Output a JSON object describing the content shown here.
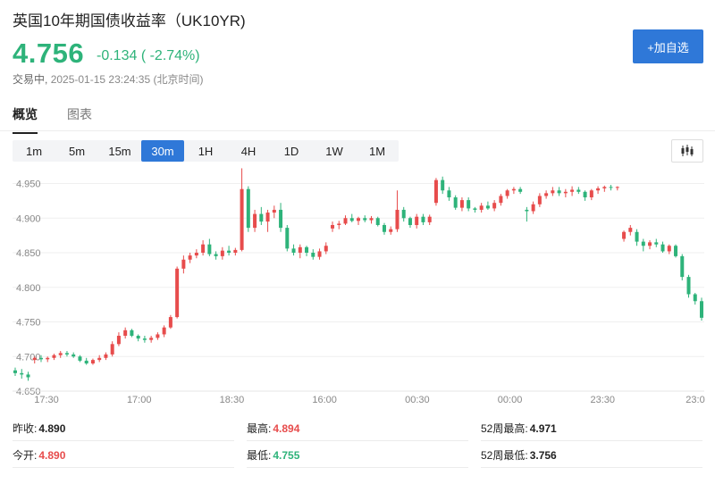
{
  "header": {
    "title": "英国10年期国债收益率（UK10YR)",
    "price": "4.756",
    "change": "-0.134 ( -2.74%)",
    "status": "交易中,",
    "timestamp": "2025-01-15 23:24:35 (北京时间)",
    "add_button": "+加自选"
  },
  "colors": {
    "up": "#e74c4c",
    "down": "#2eb37a",
    "accent": "#2f78d8"
  },
  "tabs": [
    {
      "label": "概览",
      "active": true
    },
    {
      "label": "图表",
      "active": false
    }
  ],
  "periods": [
    {
      "label": "1m",
      "active": false
    },
    {
      "label": "5m",
      "active": false
    },
    {
      "label": "15m",
      "active": false
    },
    {
      "label": "30m",
      "active": true
    },
    {
      "label": "1H",
      "active": false
    },
    {
      "label": "4H",
      "active": false
    },
    {
      "label": "1D",
      "active": false
    },
    {
      "label": "1W",
      "active": false
    },
    {
      "label": "1M",
      "active": false
    }
  ],
  "chart_type_icon": "candlestick-icon",
  "chart_data": {
    "type": "candlestick",
    "title": "",
    "xlabel": "",
    "ylabel": "",
    "ylim": [
      4.65,
      4.97
    ],
    "yticks": [
      "4.650",
      "4.700",
      "4.750",
      "4.800",
      "4.850",
      "4.900",
      "4.950"
    ],
    "xticks": [
      "17:30",
      "17:00",
      "18:30",
      "16:00",
      "00:30",
      "00:00",
      "23:30",
      "23:0"
    ],
    "grid": true,
    "candles": [
      [
        4.68,
        4.684,
        4.672,
        4.676
      ],
      [
        4.676,
        4.682,
        4.668,
        4.674
      ],
      [
        4.674,
        4.678,
        4.665,
        4.67
      ],
      [
        4.695,
        4.7,
        4.69,
        4.698
      ],
      [
        4.698,
        4.702,
        4.692,
        4.696
      ],
      [
        4.696,
        4.7,
        4.692,
        4.698
      ],
      [
        4.698,
        4.704,
        4.695,
        4.702
      ],
      [
        4.702,
        4.708,
        4.698,
        4.705
      ],
      [
        4.705,
        4.708,
        4.7,
        4.703
      ],
      [
        4.703,
        4.706,
        4.698,
        4.7
      ],
      [
        4.7,
        4.702,
        4.692,
        4.694
      ],
      [
        4.694,
        4.698,
        4.688,
        4.69
      ],
      [
        4.69,
        4.697,
        4.688,
        4.695
      ],
      [
        4.695,
        4.702,
        4.692,
        4.698
      ],
      [
        4.698,
        4.706,
        4.695,
        4.703
      ],
      [
        4.703,
        4.722,
        4.7,
        4.718
      ],
      [
        4.718,
        4.735,
        4.715,
        4.73
      ],
      [
        4.73,
        4.742,
        4.726,
        4.738
      ],
      [
        4.738,
        4.74,
        4.728,
        4.73
      ],
      [
        4.73,
        4.732,
        4.722,
        4.726
      ],
      [
        4.726,
        4.73,
        4.72,
        4.724
      ],
      [
        4.724,
        4.73,
        4.72,
        4.727
      ],
      [
        4.727,
        4.735,
        4.724,
        4.732
      ],
      [
        4.732,
        4.745,
        4.728,
        4.742
      ],
      [
        4.742,
        4.76,
        4.74,
        4.757
      ],
      [
        4.757,
        4.83,
        4.755,
        4.827
      ],
      [
        4.827,
        4.846,
        4.82,
        4.84
      ],
      [
        4.84,
        4.85,
        4.835,
        4.846
      ],
      [
        4.846,
        4.855,
        4.842,
        4.85
      ],
      [
        4.85,
        4.868,
        4.846,
        4.862
      ],
      [
        4.862,
        4.87,
        4.845,
        4.848
      ],
      [
        4.848,
        4.852,
        4.84,
        4.845
      ],
      [
        4.845,
        4.858,
        4.84,
        4.853
      ],
      [
        4.853,
        4.86,
        4.846,
        4.85
      ],
      [
        4.85,
        4.857,
        4.846,
        4.854
      ],
      [
        4.854,
        4.972,
        4.852,
        4.942
      ],
      [
        4.942,
        4.946,
        4.88,
        4.886
      ],
      [
        4.886,
        4.912,
        4.88,
        4.906
      ],
      [
        4.906,
        4.916,
        4.89,
        4.895
      ],
      [
        4.895,
        4.912,
        4.88,
        4.908
      ],
      [
        4.908,
        4.918,
        4.9,
        4.912
      ],
      [
        4.912,
        4.922,
        4.88,
        4.886
      ],
      [
        4.886,
        4.89,
        4.852,
        4.856
      ],
      [
        4.856,
        4.862,
        4.846,
        4.85
      ],
      [
        4.85,
        4.862,
        4.842,
        4.858
      ],
      [
        4.858,
        4.86,
        4.845,
        4.85
      ],
      [
        4.85,
        4.855,
        4.84,
        4.844
      ],
      [
        4.844,
        4.856,
        4.84,
        4.852
      ],
      [
        4.852,
        4.865,
        4.848,
        4.86
      ],
      [
        4.885,
        4.895,
        4.88,
        4.89
      ],
      [
        4.89,
        4.896,
        4.884,
        4.892
      ],
      [
        4.892,
        4.904,
        4.89,
        4.9
      ],
      [
        4.9,
        4.906,
        4.894,
        4.896
      ],
      [
        4.896,
        4.902,
        4.89,
        4.9
      ],
      [
        4.9,
        4.904,
        4.894,
        4.897
      ],
      [
        4.897,
        4.903,
        4.892,
        4.9
      ],
      [
        4.9,
        4.902,
        4.888,
        4.89
      ],
      [
        4.89,
        4.893,
        4.876,
        4.88
      ],
      [
        4.88,
        4.888,
        4.876,
        4.884
      ],
      [
        4.884,
        4.94,
        4.88,
        4.912
      ],
      [
        4.912,
        4.916,
        4.895,
        4.9
      ],
      [
        4.9,
        4.902,
        4.886,
        4.89
      ],
      [
        4.89,
        4.906,
        4.885,
        4.902
      ],
      [
        4.902,
        4.906,
        4.89,
        4.894
      ],
      [
        4.894,
        4.905,
        4.89,
        4.902
      ],
      [
        4.922,
        4.958,
        4.918,
        4.955
      ],
      [
        4.955,
        4.96,
        4.935,
        4.94
      ],
      [
        4.94,
        4.945,
        4.925,
        4.93
      ],
      [
        4.93,
        4.933,
        4.912,
        4.915
      ],
      [
        4.915,
        4.93,
        4.91,
        4.926
      ],
      [
        4.926,
        4.93,
        4.91,
        4.914
      ],
      [
        4.914,
        4.916,
        4.908,
        4.912
      ],
      [
        4.912,
        4.922,
        4.908,
        4.918
      ],
      [
        4.918,
        4.924,
        4.912,
        4.914
      ],
      [
        4.914,
        4.926,
        4.91,
        4.922
      ],
      [
        4.922,
        4.935,
        4.918,
        4.932
      ],
      [
        4.932,
        4.942,
        4.928,
        4.94
      ],
      [
        4.94,
        4.945,
        4.935,
        4.942
      ],
      [
        4.942,
        4.945,
        4.935,
        4.938
      ],
      [
        4.912,
        4.916,
        4.895,
        4.91
      ],
      [
        4.91,
        4.924,
        4.906,
        4.92
      ],
      [
        4.92,
        4.936,
        4.916,
        4.932
      ],
      [
        4.932,
        4.94,
        4.928,
        4.936
      ],
      [
        4.936,
        4.945,
        4.932,
        4.94
      ],
      [
        4.94,
        4.945,
        4.932,
        4.936
      ],
      [
        4.936,
        4.942,
        4.93,
        4.938
      ],
      [
        4.938,
        4.946,
        4.932,
        4.941
      ],
      [
        4.941,
        4.945,
        4.935,
        4.938
      ],
      [
        4.938,
        4.94,
        4.925,
        4.93
      ],
      [
        4.93,
        4.942,
        4.926,
        4.94
      ],
      [
        4.94,
        4.946,
        4.935,
        4.943
      ],
      [
        4.943,
        4.947,
        4.938,
        4.945
      ],
      [
        4.945,
        4.948,
        4.94,
        4.944
      ],
      [
        4.944,
        4.946,
        4.94,
        4.945
      ],
      [
        4.87,
        4.882,
        4.866,
        4.88
      ],
      [
        4.88,
        4.89,
        4.875,
        4.886
      ],
      [
        4.88,
        4.884,
        4.86,
        4.866
      ],
      [
        4.866,
        4.87,
        4.852,
        4.86
      ],
      [
        4.86,
        4.868,
        4.855,
        4.865
      ],
      [
        4.865,
        4.87,
        4.858,
        4.862
      ],
      [
        4.862,
        4.866,
        4.85,
        4.852
      ],
      [
        4.852,
        4.862,
        4.848,
        4.86
      ],
      [
        4.86,
        4.862,
        4.843,
        4.845
      ],
      [
        4.845,
        4.848,
        4.81,
        4.815
      ],
      [
        4.815,
        4.818,
        4.785,
        4.79
      ],
      [
        4.79,
        4.792,
        4.775,
        4.78
      ],
      [
        4.78,
        4.785,
        4.752,
        4.756
      ]
    ]
  },
  "stats": [
    {
      "label": "昨收:",
      "value": "4.890",
      "color": "plain"
    },
    {
      "label": "最高:",
      "value": "4.894",
      "color": "up"
    },
    {
      "label": "52周最高:",
      "value": "4.971",
      "color": "plain"
    },
    {
      "label": "今开:",
      "value": "4.890",
      "color": "up"
    },
    {
      "label": "最低:",
      "value": "4.755",
      "color": "down"
    },
    {
      "label": "52周最低:",
      "value": "3.756",
      "color": "plain"
    }
  ]
}
